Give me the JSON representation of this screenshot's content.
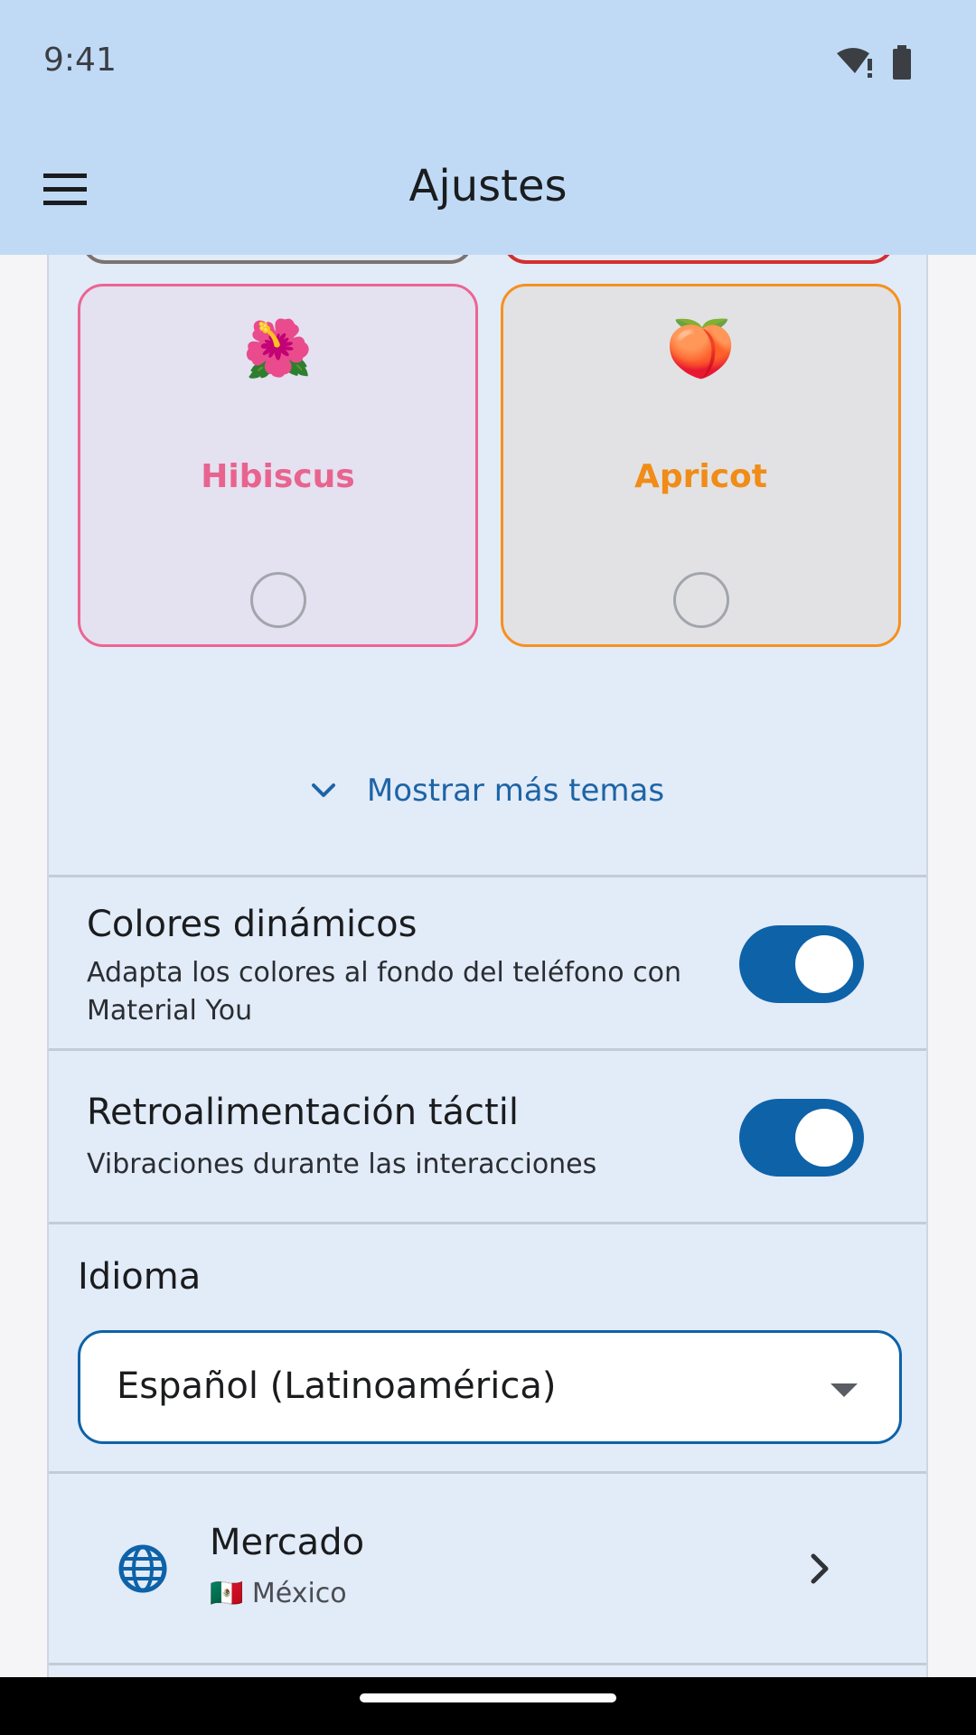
{
  "status_bar": {
    "time": "9:41",
    "icons": [
      "wifi-alert-icon",
      "battery-icon"
    ]
  },
  "app_bar": {
    "menu_icon": "menu-icon",
    "title": "Ajustes"
  },
  "themes": {
    "cards": [
      {
        "emoji": "🌺",
        "name": "Hibiscus",
        "selected": false,
        "accent": "#ec6592"
      },
      {
        "emoji": "🍑",
        "name": "Apricot",
        "selected": false,
        "accent": "#f5911f"
      }
    ],
    "show_more": "Mostrar más temas"
  },
  "settings": {
    "dynamic_colors": {
      "title": "Colores dinámicos",
      "description": "Adapta los colores al fondo del teléfono con Material You",
      "enabled": true
    },
    "haptics": {
      "title": "Retroalimentación táctil",
      "description": "Vibraciones durante las interacciones",
      "enabled": true
    },
    "language": {
      "label": "Idioma",
      "selected": "Español (Latinoamérica)"
    },
    "market": {
      "title": "Mercado",
      "flag": "🇲🇽",
      "value": "México",
      "icon": "globe-icon"
    }
  },
  "colors": {
    "accent": "#0e62a8",
    "app_bar": "#c0daf6",
    "surface": "#e2ebf8"
  }
}
